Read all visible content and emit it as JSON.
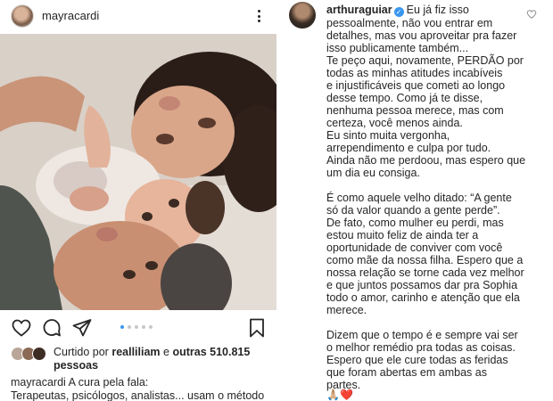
{
  "post": {
    "username": "mayracardi",
    "likes_prefix": "Curtido por",
    "likes_user": "realliliam",
    "likes_conj": "e",
    "likes_others": "outras 510.815",
    "likes_suffix": "pessoas",
    "caption_user": "mayracardi",
    "caption_text": "A cura pela fala:",
    "caption_cut": "Terapeutas, psicólogos, analistas... usam o método"
  },
  "carousel": {
    "count": 5,
    "active_index": 0
  },
  "comment": {
    "username": "arthuraguiar",
    "lines": [
      "Eu já fiz isso",
      "pessoalmente, não vou entrar em",
      "detalhes, mas vou aproveitar pra fazer",
      "isso publicamente também...",
      "Te peço aqui, novamente, PERDÃO por",
      "todas as minhas atitudes incabíveis",
      "e injustificáveis que cometi ao longo",
      "desse tempo. Como já te disse,",
      "nenhuma pessoa merece, mas com",
      "certeza, você menos ainda.",
      "Eu sinto muita vergonha,",
      "arrependimento e culpa por tudo.",
      "Ainda não me perdoou, mas espero que",
      "um dia eu consiga.",
      "",
      "É como aquele velho ditado: “A gente",
      "só da valor quando a gente perde”.",
      "De fato, como mulher eu perdi, mas",
      "estou muito feliz de ainda ter a",
      "oportunidade de conviver com você",
      "como mãe da nossa filha. Espero que a",
      "nossa relação se torne cada vez melhor",
      "e que juntos possamos dar pra Sophia",
      "todo o amor, carinho e atenção que ela",
      "merece.",
      "",
      "Dizem que o tempo é e sempre vai ser",
      "o melhor remédio pra todas as coisas.",
      "Espero que ele cure todas as feridas",
      "que foram abertas em ambas as",
      "partes."
    ],
    "emojis": "🙏🏼❤️"
  },
  "icons": {
    "more": "more-vertical-icon",
    "like": "heart-icon",
    "comment": "comment-icon",
    "share": "paper-plane-icon",
    "save": "bookmark-icon",
    "verified": "verified-badge-icon",
    "comment_like": "small-heart-icon"
  },
  "colors": {
    "accent": "#3897f0",
    "text": "#262626",
    "dot_inactive": "#c7c7c7",
    "heart_emoji": "#e0245e"
  }
}
